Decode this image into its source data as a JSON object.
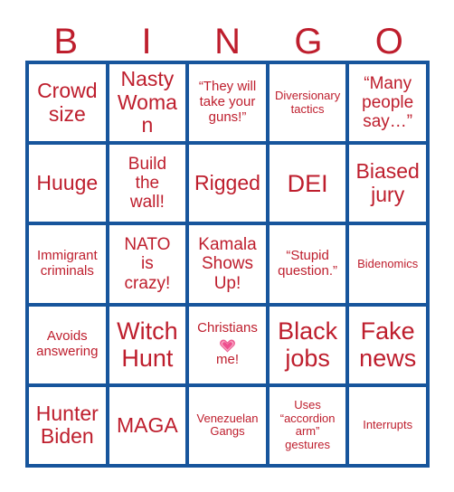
{
  "card": {
    "title": "BINGO",
    "header_letters": [
      "B",
      "I",
      "N",
      "G",
      "O"
    ],
    "colors": {
      "text_red": "#BE1E2D",
      "grid_blue": "#17559C",
      "cell_background": "#FFFFFF",
      "page_background": "#FFFFFF",
      "heart_pink": "#ED5C92"
    },
    "grid": {
      "columns": 5,
      "rows": 5,
      "free_space": false
    },
    "cells": [
      {
        "id": "b1",
        "column": "B",
        "row": 1,
        "text": "Crowd\nsize",
        "size": "lg",
        "has_heart": false
      },
      {
        "id": "i1",
        "column": "I",
        "row": 1,
        "text": "Nasty\nWoman",
        "size": "lg",
        "has_heart": false
      },
      {
        "id": "n1",
        "column": "N",
        "row": 1,
        "text": "“They will\ntake your\nguns!”",
        "size": "sm",
        "has_heart": false
      },
      {
        "id": "g1",
        "column": "G",
        "row": 1,
        "text": "Diversionary\ntactics",
        "size": "xs",
        "has_heart": false
      },
      {
        "id": "o1",
        "column": "O",
        "row": 1,
        "text": "“Many\npeople\nsay…”",
        "size": "md",
        "has_heart": false
      },
      {
        "id": "b2",
        "column": "B",
        "row": 2,
        "text": "Huuge",
        "size": "lg",
        "has_heart": false
      },
      {
        "id": "i2",
        "column": "I",
        "row": 2,
        "text": "Build\nthe\nwall!",
        "size": "md",
        "has_heart": false
      },
      {
        "id": "n2",
        "column": "N",
        "row": 2,
        "text": "Rigged",
        "size": "lg",
        "has_heart": false
      },
      {
        "id": "g2",
        "column": "G",
        "row": 2,
        "text": "DEI",
        "size": "xl",
        "has_heart": false
      },
      {
        "id": "o2",
        "column": "O",
        "row": 2,
        "text": "Biased\njury",
        "size": "lg",
        "has_heart": false
      },
      {
        "id": "b3",
        "column": "B",
        "row": 3,
        "text": "Immigrant\ncriminals",
        "size": "sm",
        "has_heart": false
      },
      {
        "id": "i3",
        "column": "I",
        "row": 3,
        "text": "NATO\nis\ncrazy!",
        "size": "md",
        "has_heart": false
      },
      {
        "id": "n3",
        "column": "N",
        "row": 3,
        "text": "Kamala\nShows\nUp!",
        "size": "md",
        "has_heart": false
      },
      {
        "id": "g3",
        "column": "G",
        "row": 3,
        "text": "“Stupid\nquestion.”",
        "size": "sm",
        "has_heart": false
      },
      {
        "id": "o3",
        "column": "O",
        "row": 3,
        "text": "Bidenomics",
        "size": "xs",
        "has_heart": false
      },
      {
        "id": "b4",
        "column": "B",
        "row": 4,
        "text": "Avoids\nanswering",
        "size": "sm",
        "has_heart": false
      },
      {
        "id": "i4",
        "column": "I",
        "row": 4,
        "text": "Witch\nHunt",
        "size": "xl",
        "has_heart": false
      },
      {
        "id": "n4",
        "column": "N",
        "row": 4,
        "text": "Christians",
        "size": "sm",
        "has_heart": true,
        "text_after_heart": "me!"
      },
      {
        "id": "g4",
        "column": "G",
        "row": 4,
        "text": "Black\njobs",
        "size": "xl",
        "has_heart": false
      },
      {
        "id": "o4",
        "column": "O",
        "row": 4,
        "text": "Fake\nnews",
        "size": "xl",
        "has_heart": false
      },
      {
        "id": "b5",
        "column": "B",
        "row": 5,
        "text": "Hunter\nBiden",
        "size": "lg",
        "has_heart": false
      },
      {
        "id": "i5",
        "column": "I",
        "row": 5,
        "text": "MAGA",
        "size": "lg",
        "has_heart": false
      },
      {
        "id": "n5",
        "column": "N",
        "row": 5,
        "text": "Venezuelan\nGangs",
        "size": "xs",
        "has_heart": false
      },
      {
        "id": "g5",
        "column": "G",
        "row": 5,
        "text": "Uses\n“accordion\narm”\ngestures",
        "size": "xs",
        "has_heart": false
      },
      {
        "id": "o5",
        "column": "O",
        "row": 5,
        "text": "Interrupts",
        "size": "xs",
        "has_heart": false
      }
    ]
  }
}
